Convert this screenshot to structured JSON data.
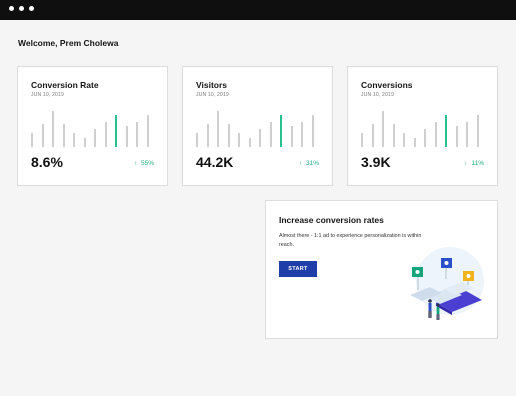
{
  "window": {
    "controls": [
      "close",
      "minimize",
      "maximize"
    ]
  },
  "welcome": "Welcome, Prem Cholewa",
  "colors": {
    "accent": "#28c08e",
    "positive": "#1fae7a",
    "button": "#1f3ea8",
    "bar": "#cfcfcf"
  },
  "cards": [
    {
      "title": "Conversion Rate",
      "date": "JUN 10, 2019",
      "value": "8.6%",
      "change": "55%",
      "change_icon": "arrow-up-icon",
      "bars": [
        0.35,
        0.57,
        0.9,
        0.57,
        0.35,
        0.23,
        0.45,
        0.62,
        0.8,
        0.52,
        0.62,
        0.8
      ],
      "highlight_index": 8
    },
    {
      "title": "Visitors",
      "date": "JUN 10, 2019",
      "value": "44.2K",
      "change": "31%",
      "change_icon": "arrow-up-icon",
      "bars": [
        0.35,
        0.57,
        0.9,
        0.57,
        0.35,
        0.23,
        0.45,
        0.62,
        0.8,
        0.52,
        0.62,
        0.8
      ],
      "highlight_index": 8
    },
    {
      "title": "Conversions",
      "date": "JUN 10, 2019",
      "value": "3.9K",
      "change": "11%",
      "change_icon": "arrow-up-icon",
      "bars": [
        0.35,
        0.57,
        0.9,
        0.57,
        0.35,
        0.23,
        0.45,
        0.62,
        0.8,
        0.52,
        0.62,
        0.8
      ],
      "highlight_index": 8
    }
  ],
  "promo": {
    "title": "Increase conversion rates",
    "text": "Almost there - 1:1 ad to experience personalization is within reach.",
    "button_label": "START",
    "illustration": "personalization-illustration"
  }
}
